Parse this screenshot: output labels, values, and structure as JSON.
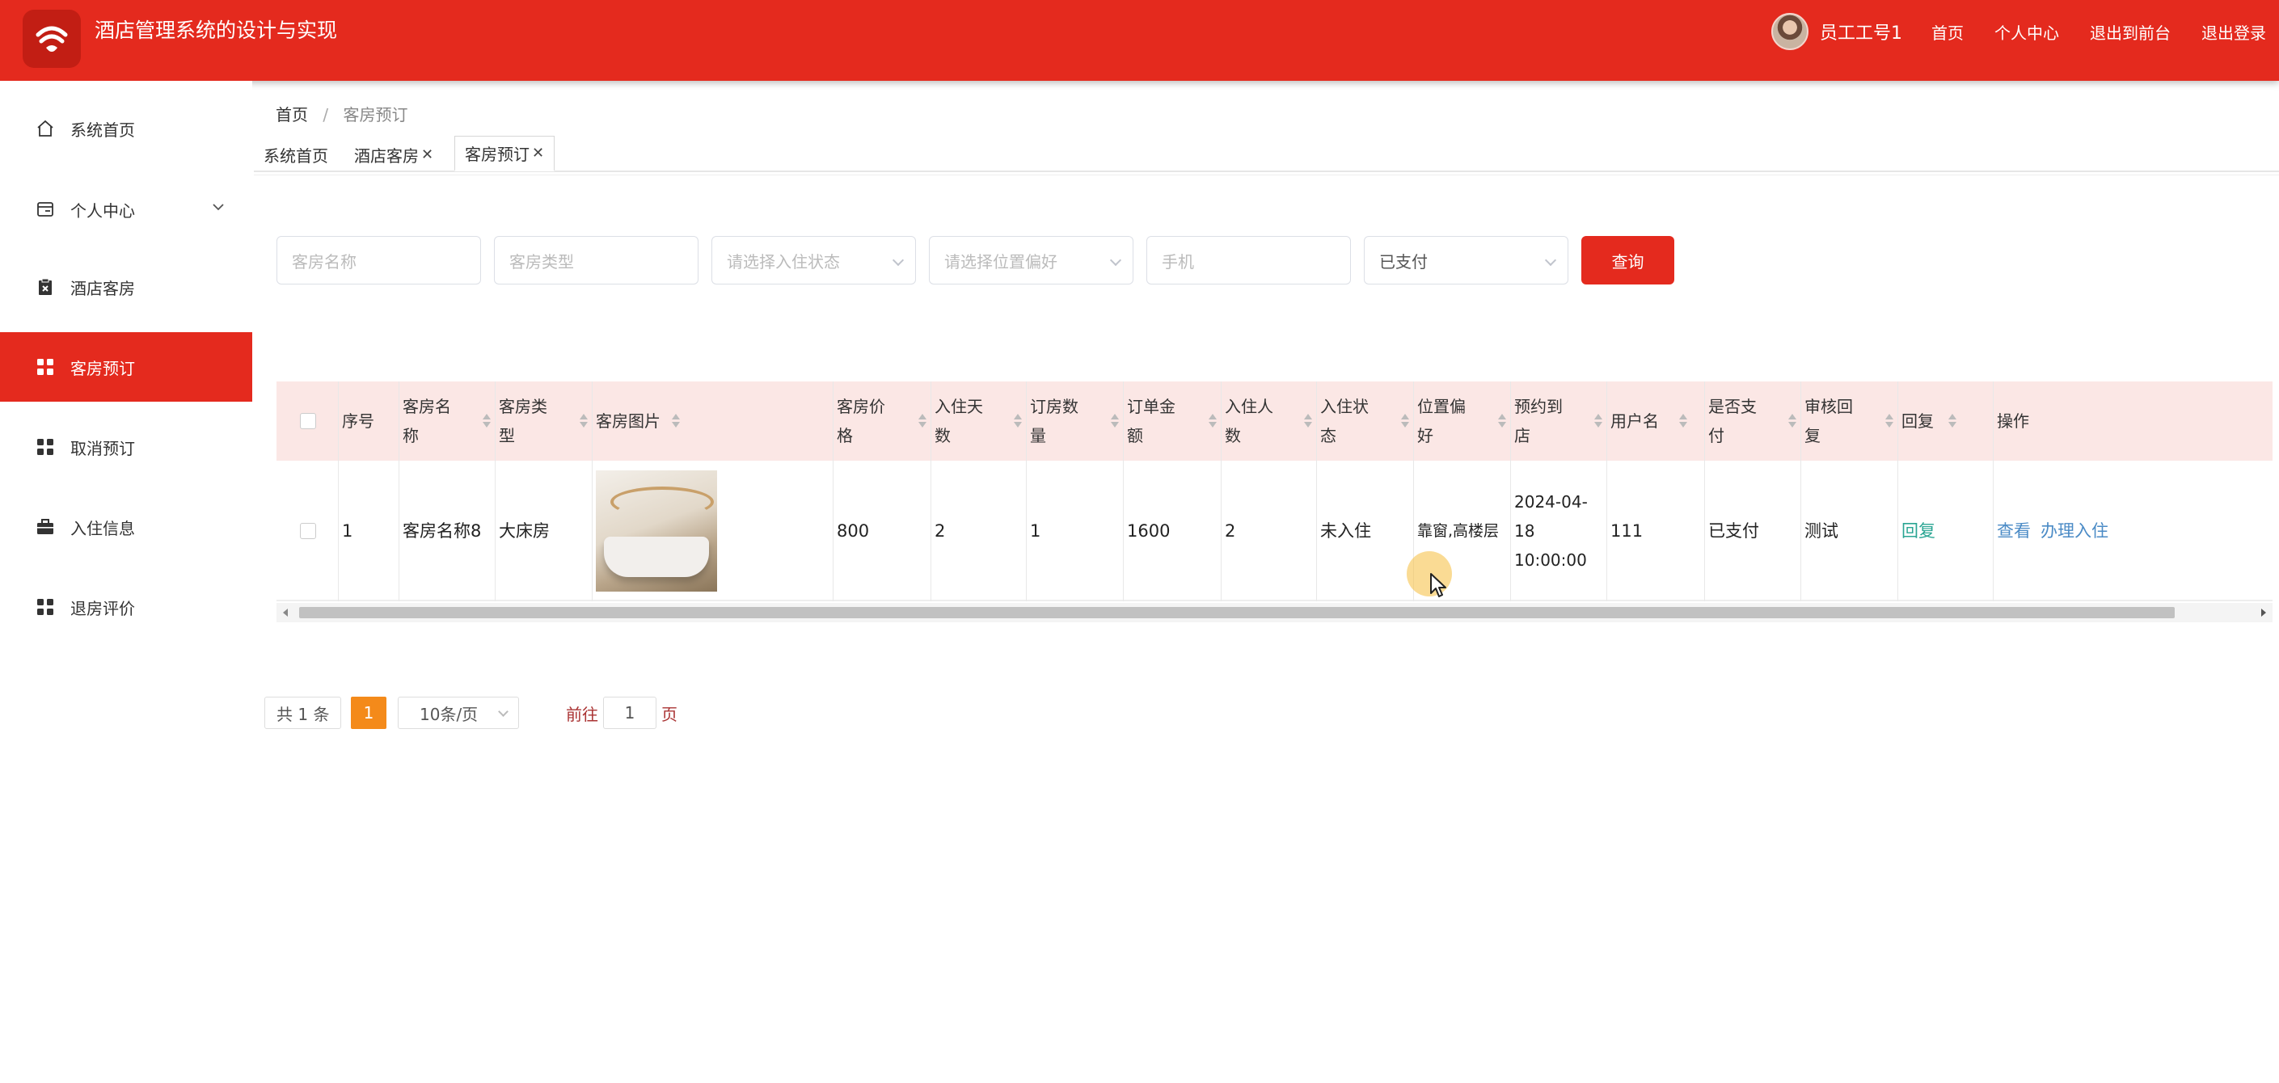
{
  "header": {
    "title": "酒店管理系统的设计与实现",
    "username": "员工工号1",
    "nav": [
      "首页",
      "个人中心",
      "退出到前台",
      "退出登录"
    ],
    "brand_color": "#e42a1e"
  },
  "sidebar": {
    "items": [
      {
        "label": "系统首页",
        "icon": "home-icon"
      },
      {
        "label": "个人中心",
        "icon": "card-icon"
      },
      {
        "label": "酒店客房",
        "icon": "clipboard-icon"
      },
      {
        "label": "客房预订",
        "icon": "grid-icon"
      },
      {
        "label": "取消预订",
        "icon": "grid-icon"
      },
      {
        "label": "入住信息",
        "icon": "briefcase-icon"
      },
      {
        "label": "退房评价",
        "icon": "grid-icon"
      }
    ]
  },
  "breadcrumb": {
    "home": "首页",
    "separator": "/",
    "current": "客房预订"
  },
  "tabs": [
    {
      "label": "系统首页"
    },
    {
      "label": "酒店客房",
      "close": "✕"
    },
    {
      "label": "客房预订",
      "close": "✕"
    }
  ],
  "search": {
    "room_name_placeholder": "客房名称",
    "room_type_placeholder": "客房类型",
    "checkin_status_placeholder": "请选择入住状态",
    "location_pref_placeholder": "请选择位置偏好",
    "phone_placeholder": "手机",
    "payment_value": "已支付",
    "button": "查询"
  },
  "table": {
    "headers": [
      "序号",
      "客房名称",
      "客房类型",
      "客房图片",
      "客房价格",
      "入住天数",
      "订房数量",
      "订单金额",
      "入住人数",
      "入住状态",
      "位置偏好",
      "预约到店",
      "用户名",
      "是否支付",
      "审核回复",
      "回复",
      "操作"
    ],
    "header_lines": [
      [
        "序号"
      ],
      [
        "客房名",
        "称"
      ],
      [
        "客房类",
        "型"
      ],
      [
        "客房图片"
      ],
      [
        "客房价",
        "格"
      ],
      [
        "入住天",
        "数"
      ],
      [
        "订房数",
        "量"
      ],
      [
        "订单金",
        "额"
      ],
      [
        "入住人",
        "数"
      ],
      [
        "入住状",
        "态"
      ],
      [
        "位置偏",
        "好"
      ],
      [
        "预约到",
        "店"
      ],
      [
        "用户名"
      ],
      [
        "是否支",
        "付"
      ],
      [
        "审核回",
        "复"
      ],
      [
        "回复"
      ],
      [
        "操作"
      ]
    ],
    "rows": [
      {
        "index": "1",
        "room_name": "客房名称8",
        "room_type": "大床房",
        "price": "800",
        "days": "2",
        "quantity": "1",
        "amount": "1600",
        "guests": "2",
        "status": "未入住",
        "location_pref": "靠窗,高楼层",
        "arrival_date": "2024-04-18",
        "arrival_time": "10:00:00",
        "username": "111",
        "paid": "已支付",
        "review_reply": "测试",
        "reply_action": "回复",
        "view_action": "查看",
        "checkin_action": "办理入住"
      }
    ]
  },
  "pagination": {
    "total": "共 1 条",
    "current_page": "1",
    "page_size": "10条/页",
    "goto_prefix": "前往",
    "goto_value": "1",
    "goto_suffix": "页"
  }
}
